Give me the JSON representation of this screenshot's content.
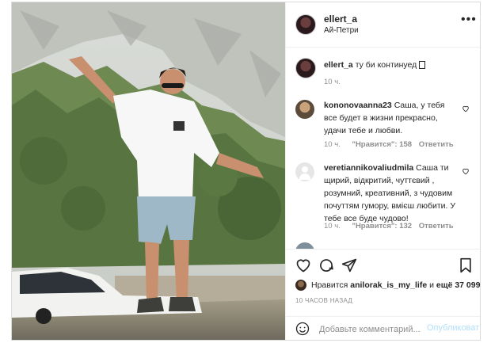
{
  "post": {
    "username": "ellert_a",
    "location": "Ай-Петри"
  },
  "comments": [
    {
      "user": "ellert_a",
      "text": "ту би континуед",
      "time": "10 ч.",
      "likes_label": "",
      "reply": ""
    },
    {
      "user": "kononovaanna23",
      "text": "Саша, у тебя все будет в жизни прекрасно, удачи тебе и любви.",
      "time": "10 ч.",
      "likes_label": "\"Нравится\": 158",
      "reply": "Ответить"
    },
    {
      "user": "veretiannikovaliudmila",
      "text": "Саша ти щирий, відкритий, чуттєвий , розумний, креативний, з чудовим почуттям гумору, вмієш любити. У тебе все буде чудово!",
      "time": "10 ч.",
      "likes_label": "\"Нравится\": 132",
      "reply": "Ответить"
    }
  ],
  "likes": {
    "prefix": "Нравится",
    "user": "anilorak_is_my_life",
    "and": "и",
    "rest": "ещё 37 099"
  },
  "posted_ago": "10 ЧАСОВ НАЗАД",
  "add_comment": {
    "placeholder": "Добавьте комментарий...",
    "publish": "Опубликовать"
  },
  "colors": {
    "border": "#dbdbdb",
    "text": "#262626",
    "muted": "#8e8e8e",
    "publish_disabled": "#b2dffc"
  },
  "icons": [
    "more-options-icon",
    "heart-icon",
    "comment-icon",
    "share-icon",
    "bookmark-icon",
    "emoji-icon",
    "comment-like-icon"
  ]
}
